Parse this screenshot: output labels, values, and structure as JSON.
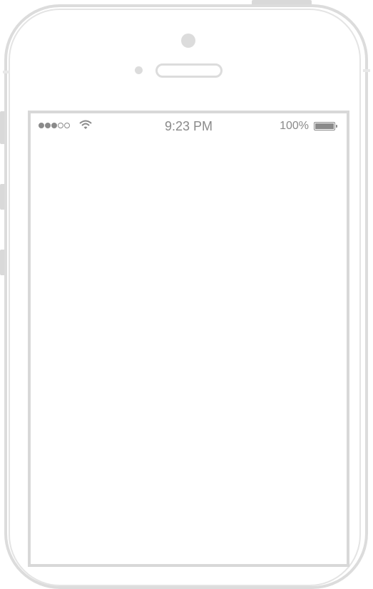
{
  "status_bar": {
    "signal_bars_total": 5,
    "signal_bars_filled": 3,
    "time": "9:23 PM",
    "battery_percent_label": "100%",
    "battery_level": 1.0,
    "icons": [
      "signal-dots-icon",
      "wifi-icon",
      "battery-icon"
    ]
  },
  "colors": {
    "device_outline": "#dcdcdc",
    "status_text": "#8a8a8a",
    "screen_background": "#ffffff"
  }
}
